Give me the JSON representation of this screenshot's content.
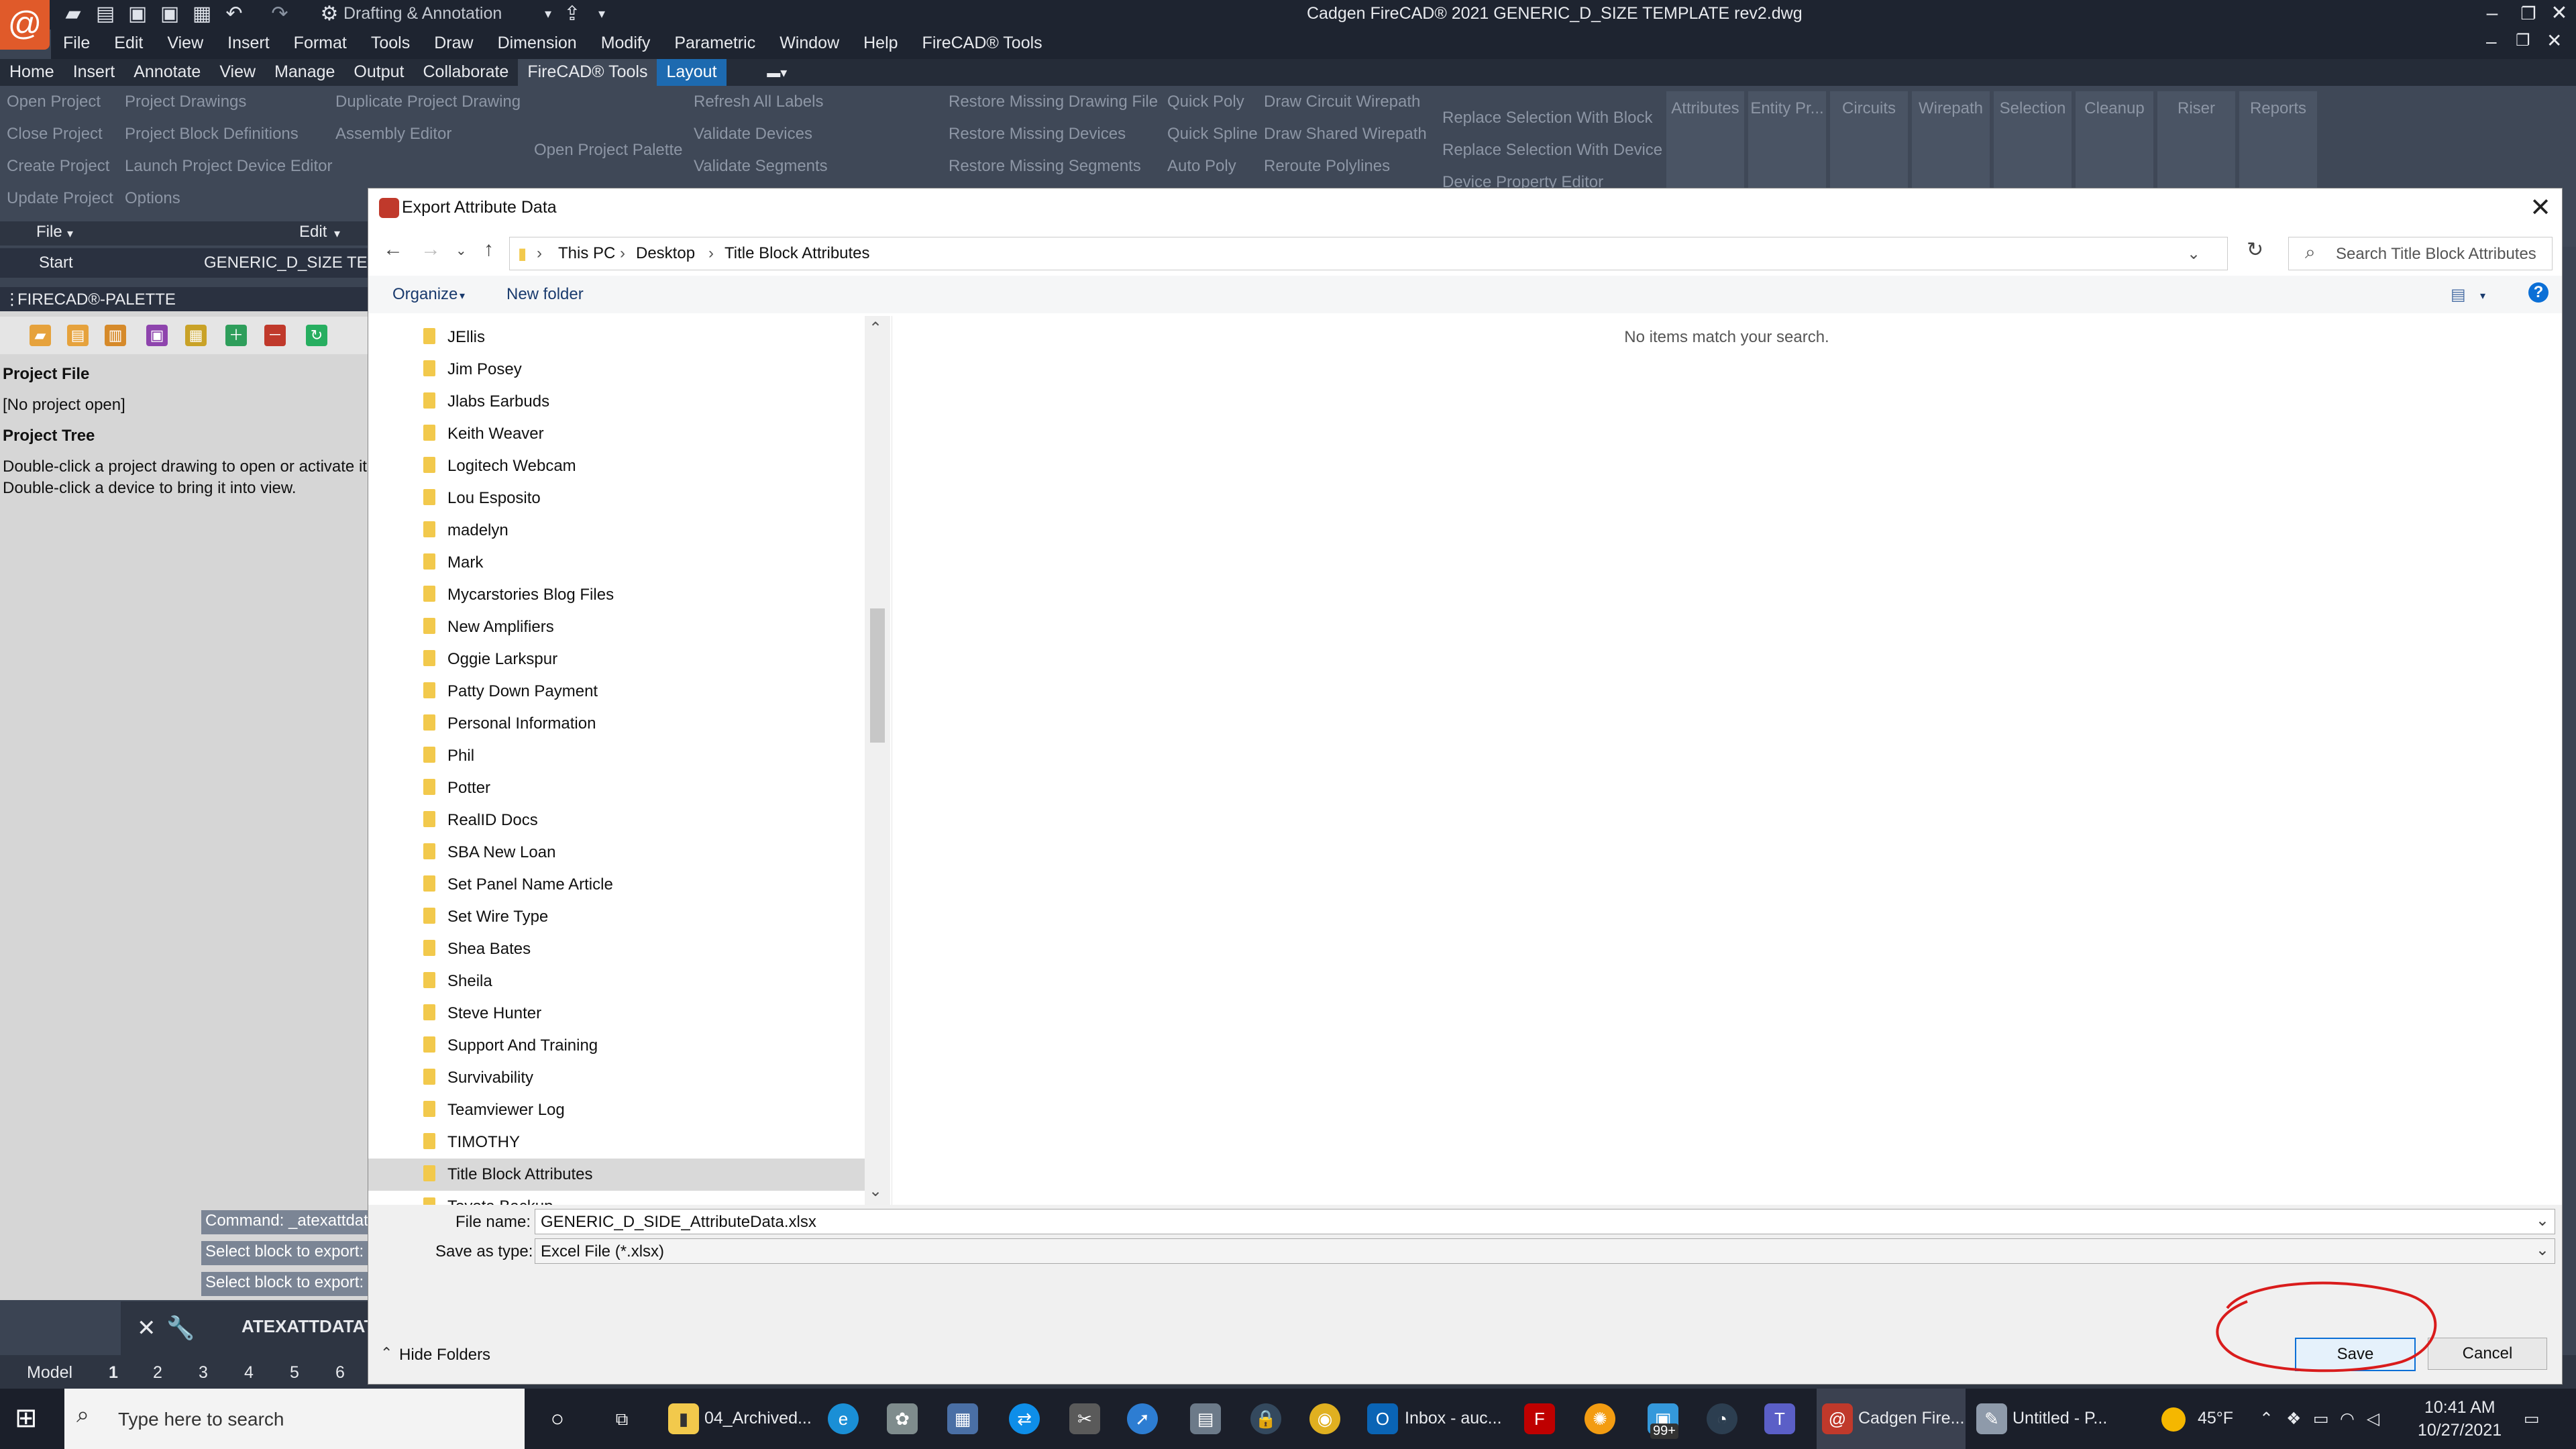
{
  "window": {
    "title": "Cadgen FireCAD® 2021    GENERIC_D_SIZE TEMPLATE rev2.dwg",
    "workspace": "Drafting & Annotation"
  },
  "menubar": [
    "File",
    "Edit",
    "View",
    "Insert",
    "Format",
    "Tools",
    "Draw",
    "Dimension",
    "Modify",
    "Parametric",
    "Window",
    "Help",
    "FireCAD® Tools"
  ],
  "ribbon_tabs": [
    "Home",
    "Insert",
    "Annotate",
    "View",
    "Manage",
    "Output",
    "Collaborate",
    "FireCAD® Tools",
    "Layout"
  ],
  "ribbon": {
    "col1": [
      "Open Project",
      "Close Project",
      "Create Project",
      "Update Project"
    ],
    "col2": [
      "Project Drawings",
      "Project Block Definitions",
      "Launch Project Device Editor",
      "Options"
    ],
    "col3": [
      "Duplicate Project Drawing",
      "Assembly Editor"
    ],
    "open_palette": "Open Project Palette",
    "col4": [
      "Refresh All Labels",
      "Validate Devices",
      "Validate Segments"
    ],
    "col5": [
      "Restore Missing Drawing File",
      "Restore Missing Devices",
      "Restore Missing Segments"
    ],
    "col6": [
      "Quick Poly",
      "Quick Spline",
      "Auto Poly"
    ],
    "col7": [
      "Draw Circuit Wirepath",
      "Draw Shared  Wirepath",
      "Reroute Polylines"
    ],
    "col8": [
      "Replace Selection With Block",
      "Replace Selection With Device",
      "Device Property Editor"
    ],
    "panels": [
      "Attributes",
      "Entity Pr...",
      "Circuits",
      "Wirepath",
      "Selection",
      "Cleanup",
      "Riser",
      "Reports"
    ],
    "footer": [
      "File",
      "Edit"
    ]
  },
  "doc_tabs": [
    "Start",
    "GENERIC_D_SIZE TEMP"
  ],
  "palette": {
    "title": "FIRECAD®-PALETTE",
    "project_file_label": "Project File",
    "project_file_value": "[No project open]",
    "project_tree_label": "Project Tree",
    "hint1": "Double-click a project drawing to open or activate it",
    "hint2": "Double-click a device to bring it into view."
  },
  "command_history": [
    "Command: _atexattdata",
    "Select block to export:",
    "Select block to export:"
  ],
  "command_line": "ATEXATTDATATO",
  "status_tabs": [
    "Model",
    "1",
    "2",
    "3",
    "4",
    "5",
    "6"
  ],
  "dialog": {
    "title": "Export Attribute Data",
    "breadcrumb": [
      "This PC",
      "Desktop",
      "Title Block Attributes"
    ],
    "search_placeholder": "Search Title Block Attributes",
    "organize": "Organize",
    "new_folder": "New folder",
    "folders": [
      "JEllis",
      "Jim Posey",
      "Jlabs Earbuds",
      "Keith Weaver",
      "Logitech Webcam",
      "Lou Esposito",
      "madelyn",
      "Mark",
      "Mycarstories Blog Files",
      "New Amplifiers",
      "Oggie Larkspur",
      "Patty Down Payment",
      "Personal Information",
      "Phil",
      "Potter",
      "RealID Docs",
      "SBA New Loan",
      "Set Panel Name Article",
      "Set Wire Type",
      "Shea Bates",
      "Sheila",
      "Steve Hunter",
      "Support And Training",
      "Survivability",
      "Teamviewer Log",
      "TIMOTHY",
      "Title Block Attributes",
      "Toyota Backup"
    ],
    "selected_folder": "Title Block Attributes",
    "empty_message": "No items match your search.",
    "file_name_label": "File name:",
    "file_name_value": "GENERIC_D_SIDE_AttributeData.xlsx",
    "save_type_label": "Save as type:",
    "save_type_value": "Excel File (*.xlsx)",
    "hide_folders": "Hide Folders",
    "save_button": "Save",
    "cancel_button": "Cancel"
  },
  "taskbar": {
    "search_placeholder": "Type here to search",
    "items": [
      "04_Archived...",
      "Inbox - auc...",
      "Cadgen Fire...",
      "Untitled - P..."
    ],
    "badge": "99+",
    "weather": "45°F",
    "time": "10:41 AM",
    "date": "10/27/2021"
  },
  "colors": {
    "accent": "#1d6ab0",
    "annotation_circle": "#d91c1c",
    "folder": "#f2c94c"
  }
}
